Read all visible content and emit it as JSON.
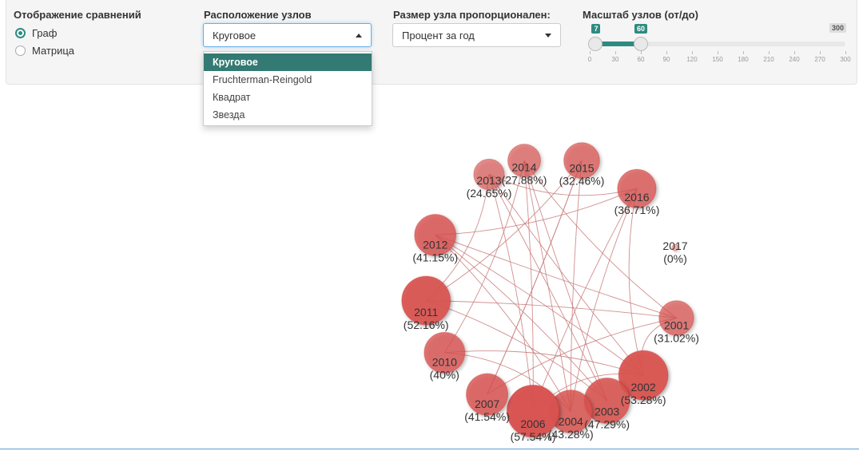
{
  "comparison": {
    "label": "Отображение сравнений",
    "options": [
      {
        "label": "Граф",
        "selected": true
      },
      {
        "label": "Матрица",
        "selected": false
      }
    ]
  },
  "layout": {
    "label": "Расположение узлов",
    "value": "Круговое",
    "options": [
      "Круговое",
      "Fruchterman-Reingold",
      "Квадрат",
      "Звезда"
    ]
  },
  "node_size": {
    "label": "Размер узла пропорционален:",
    "value": "Процент за год"
  },
  "scale": {
    "label": "Масштаб узлов (от/до)",
    "min": 0,
    "max": 300,
    "from": 7,
    "to": 60,
    "max_label": "300",
    "from_label": "7",
    "to_label": "60",
    "ticks": [
      "0",
      "30",
      "60",
      "90",
      "120",
      "150",
      "180",
      "210",
      "240",
      "270",
      "300"
    ],
    "accent_color": "#2e8b80"
  },
  "graph": {
    "nodes": [
      {
        "id": "2001",
        "year": "2001",
        "pct_label": "(31.02%)",
        "pct": 31.02
      },
      {
        "id": "2002",
        "year": "2002",
        "pct_label": "(53.28%)",
        "pct": 53.28
      },
      {
        "id": "2003",
        "year": "2003",
        "pct_label": "(47.29%)",
        "pct": 47.29
      },
      {
        "id": "2004",
        "year": "2004",
        "pct_label": "(43.28%)",
        "pct": 43.28
      },
      {
        "id": "2006",
        "year": "2006",
        "pct_label": "(57.54%)",
        "pct": 57.54
      },
      {
        "id": "2007",
        "year": "2007",
        "pct_label": "(41.54%)",
        "pct": 41.54
      },
      {
        "id": "2010",
        "year": "2010",
        "pct_label": "(40%)",
        "pct": 40
      },
      {
        "id": "2011",
        "year": "2011",
        "pct_label": "(52.16%)",
        "pct": 52.16
      },
      {
        "id": "2012",
        "year": "2012",
        "pct_label": "(41.15%)",
        "pct": 41.15
      },
      {
        "id": "2013",
        "year": "2013",
        "pct_label": "(24.65%)",
        "pct": 24.65
      },
      {
        "id": "2014",
        "year": "2014",
        "pct_label": "(27.88%)",
        "pct": 27.88
      },
      {
        "id": "2015",
        "year": "2015",
        "pct_label": "(32.46%)",
        "pct": 32.46
      },
      {
        "id": "2016",
        "year": "2016",
        "pct_label": "(36.71%)",
        "pct": 36.71
      },
      {
        "id": "2017",
        "year": "2017",
        "pct_label": "(0%)",
        "pct": 0
      }
    ],
    "edges": [
      [
        "2013",
        "2016"
      ],
      [
        "2013",
        "2002"
      ],
      [
        "2013",
        "2006"
      ],
      [
        "2013",
        "2011"
      ],
      [
        "2014",
        "2003"
      ],
      [
        "2014",
        "2006"
      ],
      [
        "2014",
        "2001"
      ],
      [
        "2014",
        "2010"
      ],
      [
        "2015",
        "2007"
      ],
      [
        "2015",
        "2004"
      ],
      [
        "2015",
        "2011"
      ],
      [
        "2016",
        "2002"
      ],
      [
        "2016",
        "2012"
      ],
      [
        "2016",
        "2004"
      ],
      [
        "2012",
        "2002"
      ],
      [
        "2012",
        "2003"
      ],
      [
        "2012",
        "2001"
      ],
      [
        "2011",
        "2001"
      ],
      [
        "2011",
        "2003"
      ],
      [
        "2010",
        "2002"
      ],
      [
        "2010",
        "2004"
      ],
      [
        "2007",
        "2001"
      ],
      [
        "2007",
        "2015"
      ],
      [
        "2006",
        "2002"
      ],
      [
        "2006",
        "2016"
      ],
      [
        "2004",
        "2012"
      ],
      [
        "2004",
        "2014"
      ],
      [
        "2003",
        "2013"
      ],
      [
        "2001",
        "2002"
      ]
    ],
    "edge_color": "#c97a7a",
    "node_color": "#d9534f"
  }
}
